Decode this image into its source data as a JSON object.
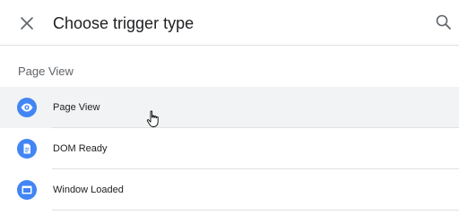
{
  "header": {
    "title": "Choose trigger type",
    "close_icon": "close-icon",
    "search_icon": "search-icon"
  },
  "section": {
    "label": "Page View"
  },
  "items": [
    {
      "label": "Page View",
      "icon": "eye-icon",
      "hovered": true
    },
    {
      "label": "DOM Ready",
      "icon": "document-icon",
      "hovered": false
    },
    {
      "label": "Window Loaded",
      "icon": "window-icon",
      "hovered": false
    }
  ],
  "colors": {
    "icon_bg": "#4285f4",
    "hover_bg": "#f1f3f4",
    "text_primary": "#202124",
    "text_secondary": "#5f6368",
    "divider": "#e0e0e0"
  }
}
